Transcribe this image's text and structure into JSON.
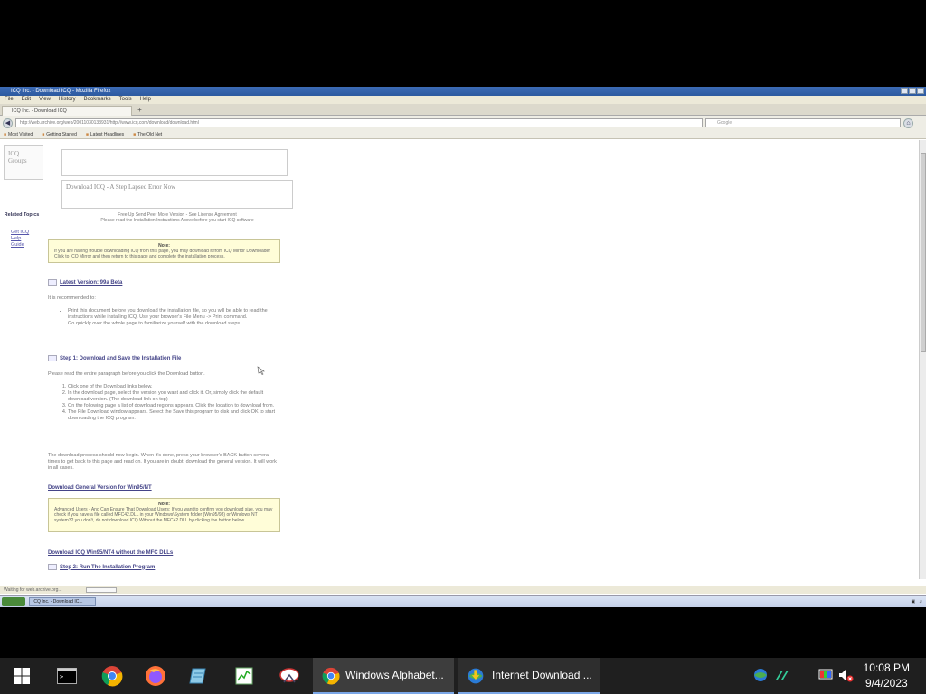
{
  "window": {
    "title": "ICQ Inc. - Download ICQ - Mozilla Firefox",
    "menu": [
      "File",
      "Edit",
      "View",
      "History",
      "Bookmarks",
      "Tools",
      "Help"
    ],
    "tab_label": "ICQ Inc. - Download ICQ",
    "url": "http://web.archive.org/web/20011030133931/http://www.icq.com/download/download.html",
    "search_placeholder": "Google",
    "bookmarks": [
      "Most Visited",
      "Getting Started",
      "Latest Headlines",
      "The Old Net"
    ]
  },
  "page": {
    "logo_text": "ICQ Groups",
    "side_heading": "Related Topics",
    "side_links": [
      "Get ICQ",
      "Help",
      "Guide"
    ],
    "banner_text": "Download ICQ - A Step Lapsed Error Now",
    "header_line1": "Free Up Send Peer More Version - See License Agreement",
    "header_line2": "Please read the Installation Instructions Above before you start ICQ software",
    "note1_title": "Note:",
    "note1_text": "If you are having trouble downloading ICQ from this page, you may download it from ICQ Mirror Downloader Click to ICQ Mirror and then return to this page and complete the installation process.",
    "sec1_title": "Latest Version: 99a Beta",
    "sec1_intro": "It is recommended to:",
    "sec1_bullets": [
      "Print this document before you download the installation file, so you will be able to read the instructions while installing ICQ. Use your browser's File Menu -> Print command.",
      "Go quickly over the whole page to familiarize yourself with the download steps."
    ],
    "sec2_title": "Step 1: Download and Save the Installation File",
    "sec2_intro": "Please read the entire paragraph before you click the Download button.",
    "sec2_steps": [
      "Click one of the Download links below.",
      "In the download page, select the version you want and click it. Or, simply click the default download version. (The download link on top)",
      "On the following page a list of download regions appears. Click the location to download from.",
      "The File Download window appears. Select the Save this program to disk and click OK to start downloading the ICQ program."
    ],
    "sec2_outro": "The download process should now begin. When it's done, press your browser's BACK button several times to get back to this page and read on. If you are in doubt, download the general version. It will work in all cases.",
    "link1": "Download General Version for Win95/NT",
    "note2_title": "Note:",
    "note2_text": "Advanced Users - And Can Ensure That Download Users: If you want to confirm you download size, you may check if you have a file called MFC42.DLL in your Windows\\System folder (Win95/98) or Windows NT system32 you don't, do not download ICQ Without the MFC42.DLL by clicking the button below.",
    "link2": "Download ICQ Win95/NT4 without the MFC DLLs",
    "sec3_title": "Step 2: Run The Installation Program"
  },
  "status_text": "Waiting for web.archive.org...",
  "remote_taskbar_item": "ICQ Inc. - Download IC...",
  "taskbar": {
    "apps": [
      "start",
      "terminal",
      "chrome",
      "firefox",
      "notepad",
      "task-manager",
      "snipping-tool"
    ],
    "window1": "Windows Alphabet...",
    "window2": "Internet Download ...",
    "time": "10:08 PM",
    "date": "9/4/2023"
  }
}
